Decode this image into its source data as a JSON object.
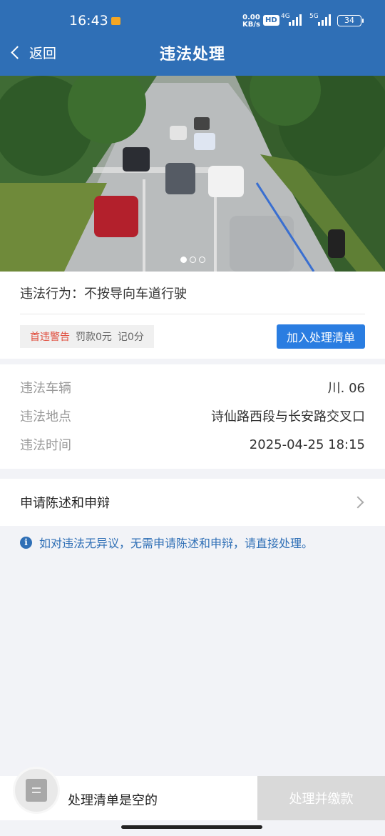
{
  "status_bar": {
    "time": "16:43",
    "net_speed_value": "0.00",
    "net_speed_unit": "KB/s",
    "hd_label": "HD",
    "net1": "4G",
    "net2": "5G",
    "battery": "34"
  },
  "nav": {
    "back_label": "返回",
    "title": "违法处理"
  },
  "photo": {
    "carousel_total": 3,
    "carousel_active": 1
  },
  "violation": {
    "behavior_label": "违法行为：",
    "behavior_value": "不按导向车道行驶",
    "warning_tag": "首违警告",
    "fine_text": "罚款0元",
    "points_text": "记0分",
    "add_button": "加入处理清单"
  },
  "details": {
    "vehicle_label": "违法车辆",
    "vehicle_value": "川.   06",
    "location_label": "违法地点",
    "location_value": "诗仙路西段与长安路交叉口",
    "time_label": "违法时间",
    "time_value": "2025-04-25 18:15"
  },
  "appeal": {
    "label": "申请陈述和申辩"
  },
  "notice": {
    "text": "如对违法无异议，无需申请陈述和申辩，请直接处理。"
  },
  "bottom": {
    "empty_text": "处理清单是空的",
    "pay_button": "处理并缴款"
  },
  "colors": {
    "header": "#2f6fb6",
    "primary_button": "#2a7de1",
    "warning_text": "#e04a3a",
    "disabled_button": "#d9d9d9"
  }
}
